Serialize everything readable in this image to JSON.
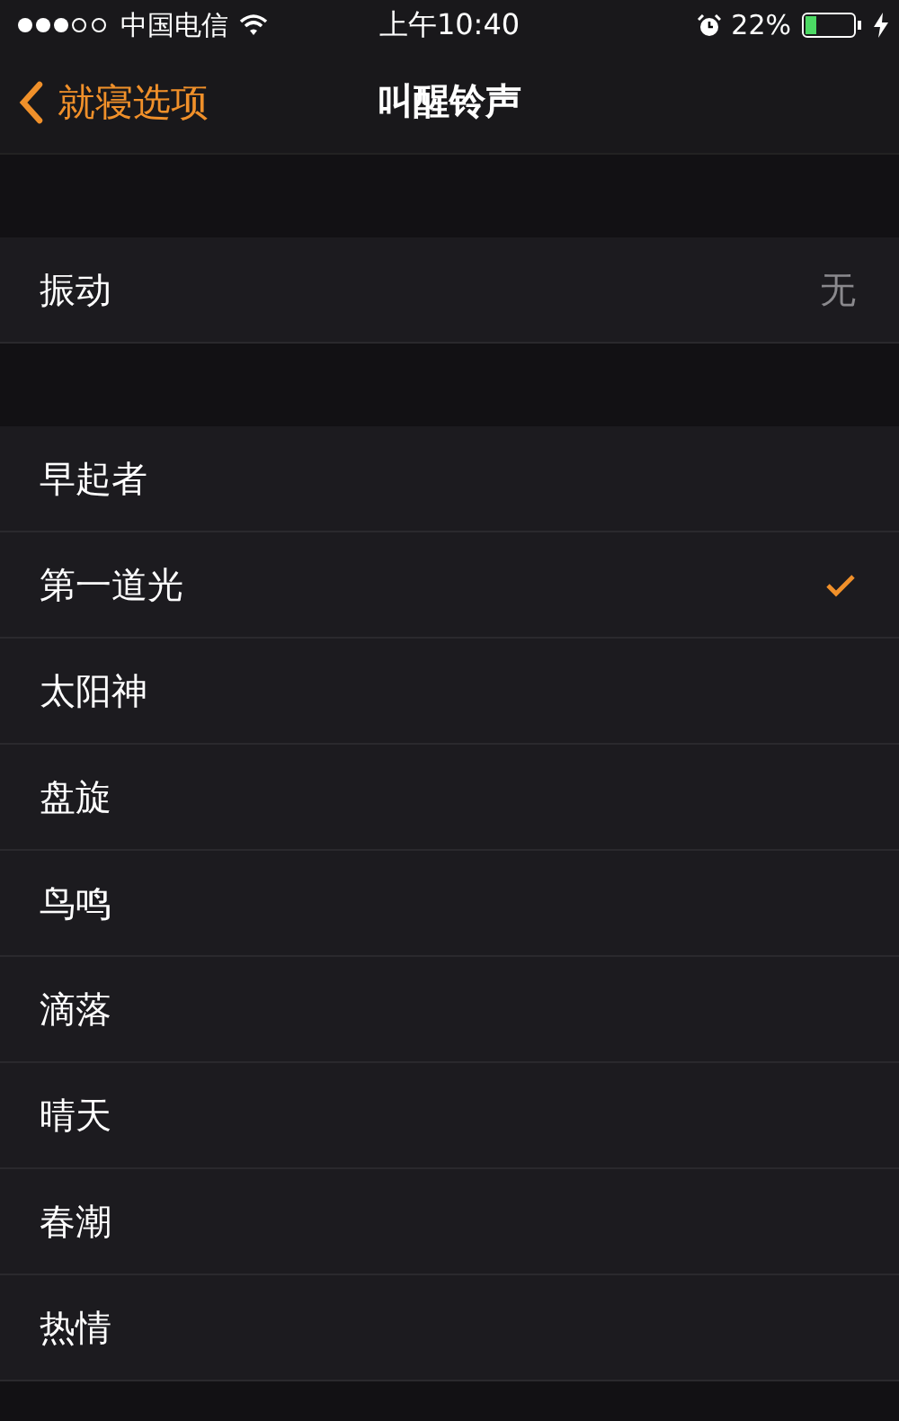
{
  "status_bar": {
    "carrier": "中国电信",
    "time": "上午10:40",
    "battery_percent": "22%"
  },
  "nav": {
    "back_label": "就寝选项",
    "title": "叫醒铃声"
  },
  "vibration": {
    "label": "振动",
    "value": "无"
  },
  "tones": [
    {
      "name": "早起者",
      "selected": false
    },
    {
      "name": "第一道光",
      "selected": true
    },
    {
      "name": "太阳神",
      "selected": false
    },
    {
      "name": "盘旋",
      "selected": false
    },
    {
      "name": "鸟鸣",
      "selected": false
    },
    {
      "name": "滴落",
      "selected": false
    },
    {
      "name": "晴天",
      "selected": false
    },
    {
      "name": "春潮",
      "selected": false
    },
    {
      "name": "热情",
      "selected": false
    }
  ]
}
